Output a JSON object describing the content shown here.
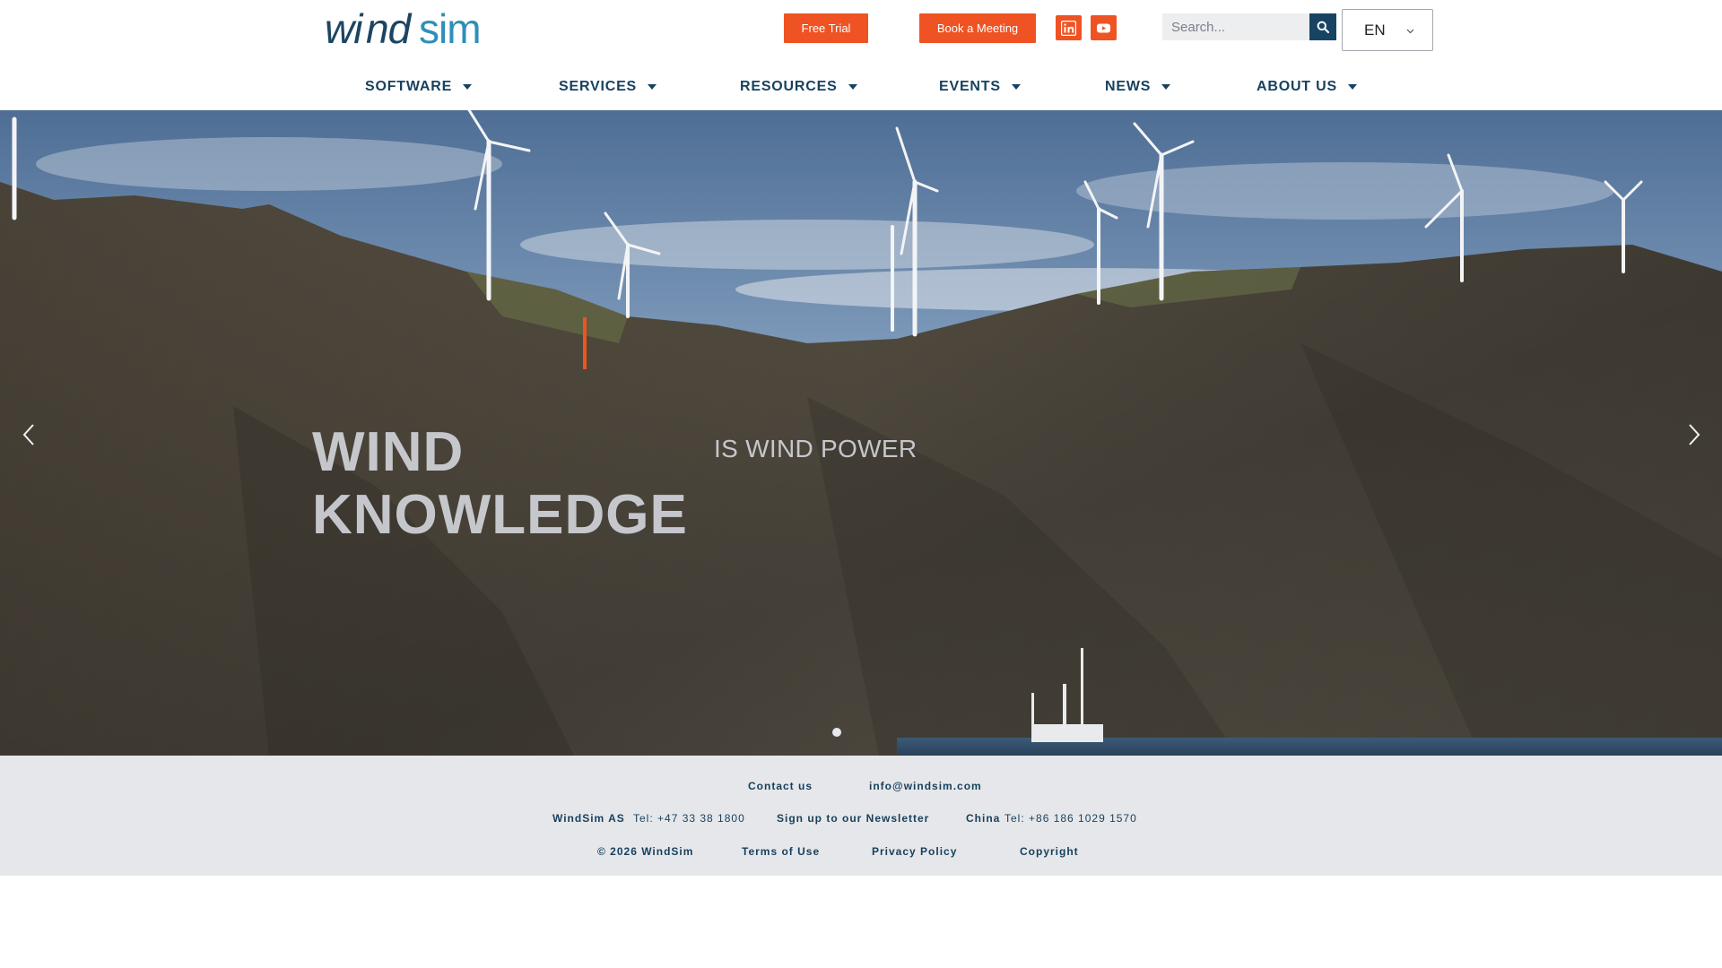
{
  "brand": {
    "logo_text": "windsim",
    "accent_color": "#ef5323",
    "navy_color": "#17425f"
  },
  "header": {
    "free_trial_label": "Free Trial",
    "book_meeting_label": "Book a Meeting",
    "social_icons": [
      "linkedin-icon",
      "youtube-icon"
    ],
    "search": {
      "placeholder": "Search..."
    },
    "language": {
      "selected": "EN"
    }
  },
  "nav": {
    "items": [
      {
        "label": "SOFTWARE"
      },
      {
        "label": "SERVICES"
      },
      {
        "label": "RESOURCES"
      },
      {
        "label": "EVENTS"
      },
      {
        "label": "NEWS"
      },
      {
        "label": "ABOUT US"
      }
    ]
  },
  "hero": {
    "title_line1": "WIND",
    "title_line2": "KNOWLEDGE",
    "subtitle": "IS WIND POWER",
    "slide_count": 1,
    "active_slide": 1
  },
  "footer": {
    "contact_us": "Contact us",
    "email": "info@windsim.com",
    "company": "WindSim AS",
    "company_tel": "Tel: +47 33 38 1800",
    "newsletter": "Sign up to our Newsletter",
    "china_label": "China",
    "china_tel": "Tel: +86 186 1029 1570",
    "copyright_line": "© 2026 WindSim",
    "terms": "Terms of Use",
    "privacy": "Privacy Policy",
    "copyright": "Copyright"
  }
}
